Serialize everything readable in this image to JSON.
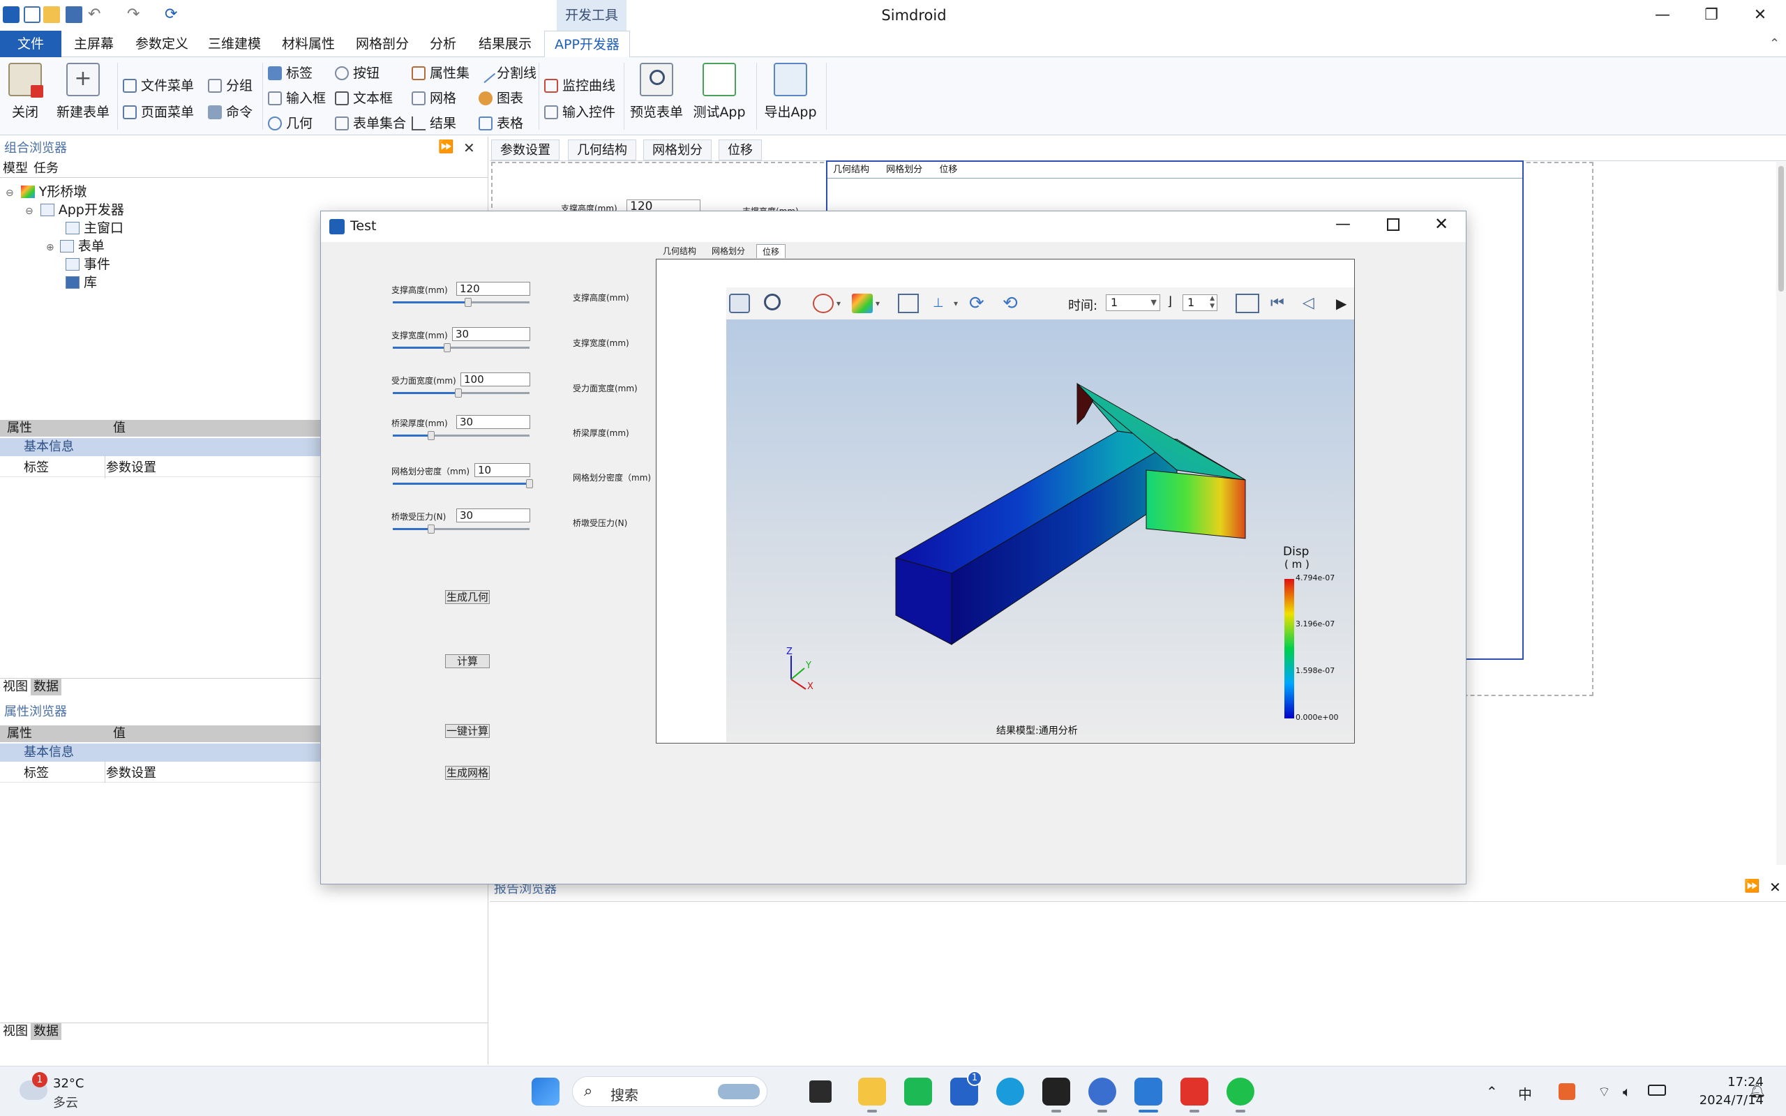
{
  "window": {
    "app_title": "Simdroid",
    "context_tab": "开发工具",
    "minimize": "—",
    "restore": "❐",
    "close": "✕"
  },
  "ribbon_tabs": [
    "文件",
    "主屏幕",
    "参数定义",
    "三维建模",
    "材料属性",
    "网格剖分",
    "分析",
    "结果展示",
    "APP开发器"
  ],
  "ribbon": {
    "close": "关闭",
    "new_form": "新建表单",
    "file_menu": "文件菜单",
    "page_menu": "页面菜单",
    "group": "分组",
    "command": "命令",
    "label": "标签",
    "input_box": "输入框",
    "geometry": "几何",
    "button": "按钮",
    "text_box": "文本框",
    "form_set": "表单集合",
    "property_set": "属性集",
    "mesh": "网格",
    "result": "结果",
    "divider": "分割线",
    "chart": "图表",
    "table": "表格",
    "monitor_curve": "监控曲线",
    "input_control": "输入控件",
    "preview_form": "预览表单",
    "test_app": "测试App",
    "export_app": "导出App"
  },
  "left": {
    "combo_browser": "组合浏览器",
    "model_tab": "模型",
    "task_tab": "任务",
    "tree": {
      "root": "Y形桥墩",
      "app_dev": "App开发器",
      "main_window": "主窗口",
      "form": "表单",
      "event": "事件",
      "library": "库"
    },
    "grid1": {
      "col_prop": "属性",
      "col_value": "值",
      "section": "基本信息",
      "row_key": "标签",
      "row_value": "参数设置"
    },
    "view_tab": "视图",
    "data_tab": "数据",
    "prop_browser": "属性浏览器",
    "grid2": {
      "col_prop": "属性",
      "col_value": "值",
      "section": "基本信息",
      "row_key": "标签",
      "row_value": "参数设置"
    },
    "view_tab2": "视图",
    "data_tab2": "数据"
  },
  "designer": {
    "tabs": [
      "参数设置",
      "几何结构",
      "网格划分",
      "位移"
    ],
    "preview_tabs": [
      "几何结构",
      "网格划分",
      "位移"
    ],
    "bg_label1": "支撑高度(mm)",
    "bg_value1": "120",
    "bg_label2": "支撑高度(mm)",
    "report_browser": "报告浏览器"
  },
  "dialog": {
    "title": "Test",
    "params": [
      {
        "label": "支撑高度(mm)",
        "value": "120",
        "level": 0.55
      },
      {
        "label": "支撑宽度(mm)",
        "value": "30",
        "level": 0.4
      },
      {
        "label": "受力面宽度(mm)",
        "value": "100",
        "level": 0.48
      },
      {
        "label": "桥梁厚度(mm)",
        "value": "30",
        "level": 0.28
      },
      {
        "label": "网格划分密度（mm)",
        "value": "10",
        "level": 1.0
      },
      {
        "label": "桥墩受压力(N)",
        "value": "30",
        "level": 0.28
      }
    ],
    "right_labels": [
      "支撑高度(mm)",
      "支撑宽度(mm)",
      "受力面宽度(mm)",
      "桥梁厚度(mm)",
      "网格划分密度（mm)",
      "桥墩受压力(N)"
    ],
    "buttons": {
      "gen_geometry": "生成几何",
      "compute": "计算",
      "one_click": "一键计算",
      "gen_mesh": "生成网格"
    },
    "viewer_tabs": [
      "几何结构",
      "网格划分",
      "位移"
    ],
    "time_label": "时间:",
    "time_value": "1",
    "step_value": "1",
    "legend_title": "Disp",
    "legend_unit": "( m )",
    "legend_ticks": [
      "4.794e-07",
      "3.196e-07",
      "1.598e-07",
      "0.000e+00"
    ],
    "model_caption": "结果模型:通用分析",
    "axes": {
      "z": "Z",
      "y": "Y",
      "x": "X"
    }
  },
  "taskbar": {
    "weather_temp": "32°C",
    "weather_desc": "多云",
    "weather_badge": "1",
    "search": "搜索",
    "store_badge": "1",
    "ime": "中",
    "time": "17:24",
    "date": "2024/7/14"
  },
  "colors": {
    "ribbon_file": "#1f5fb5",
    "section_blue": "#c7d6ec",
    "accent": "#2f6fc9"
  }
}
